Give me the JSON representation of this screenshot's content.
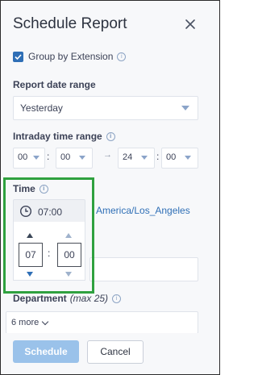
{
  "dialog": {
    "title": "Schedule Report",
    "group_by_extension": {
      "label": "Group by Extension",
      "checked": true,
      "info_icon": "info-icon"
    },
    "report_date_range": {
      "label": "Report date range",
      "value": "Yesterday"
    },
    "intraday": {
      "label": "Intraday time range",
      "start_hour": "00",
      "start_minute": "00",
      "end_hour": "24",
      "end_minute": "00",
      "arrow": "→"
    },
    "time": {
      "label": "Time",
      "value": "07:00",
      "hour": "07",
      "minute": "00",
      "separator": ":"
    },
    "timezone": "America/Los_Angeles",
    "department": {
      "label": "Department",
      "hint": "(max 25)",
      "selected": "6 more"
    },
    "buttons": {
      "primary": "Schedule",
      "secondary": "Cancel"
    }
  },
  "colors": {
    "accent": "#2f6fb6",
    "highlight": "#2fa13f",
    "primary_button": "#9ac2ea"
  }
}
